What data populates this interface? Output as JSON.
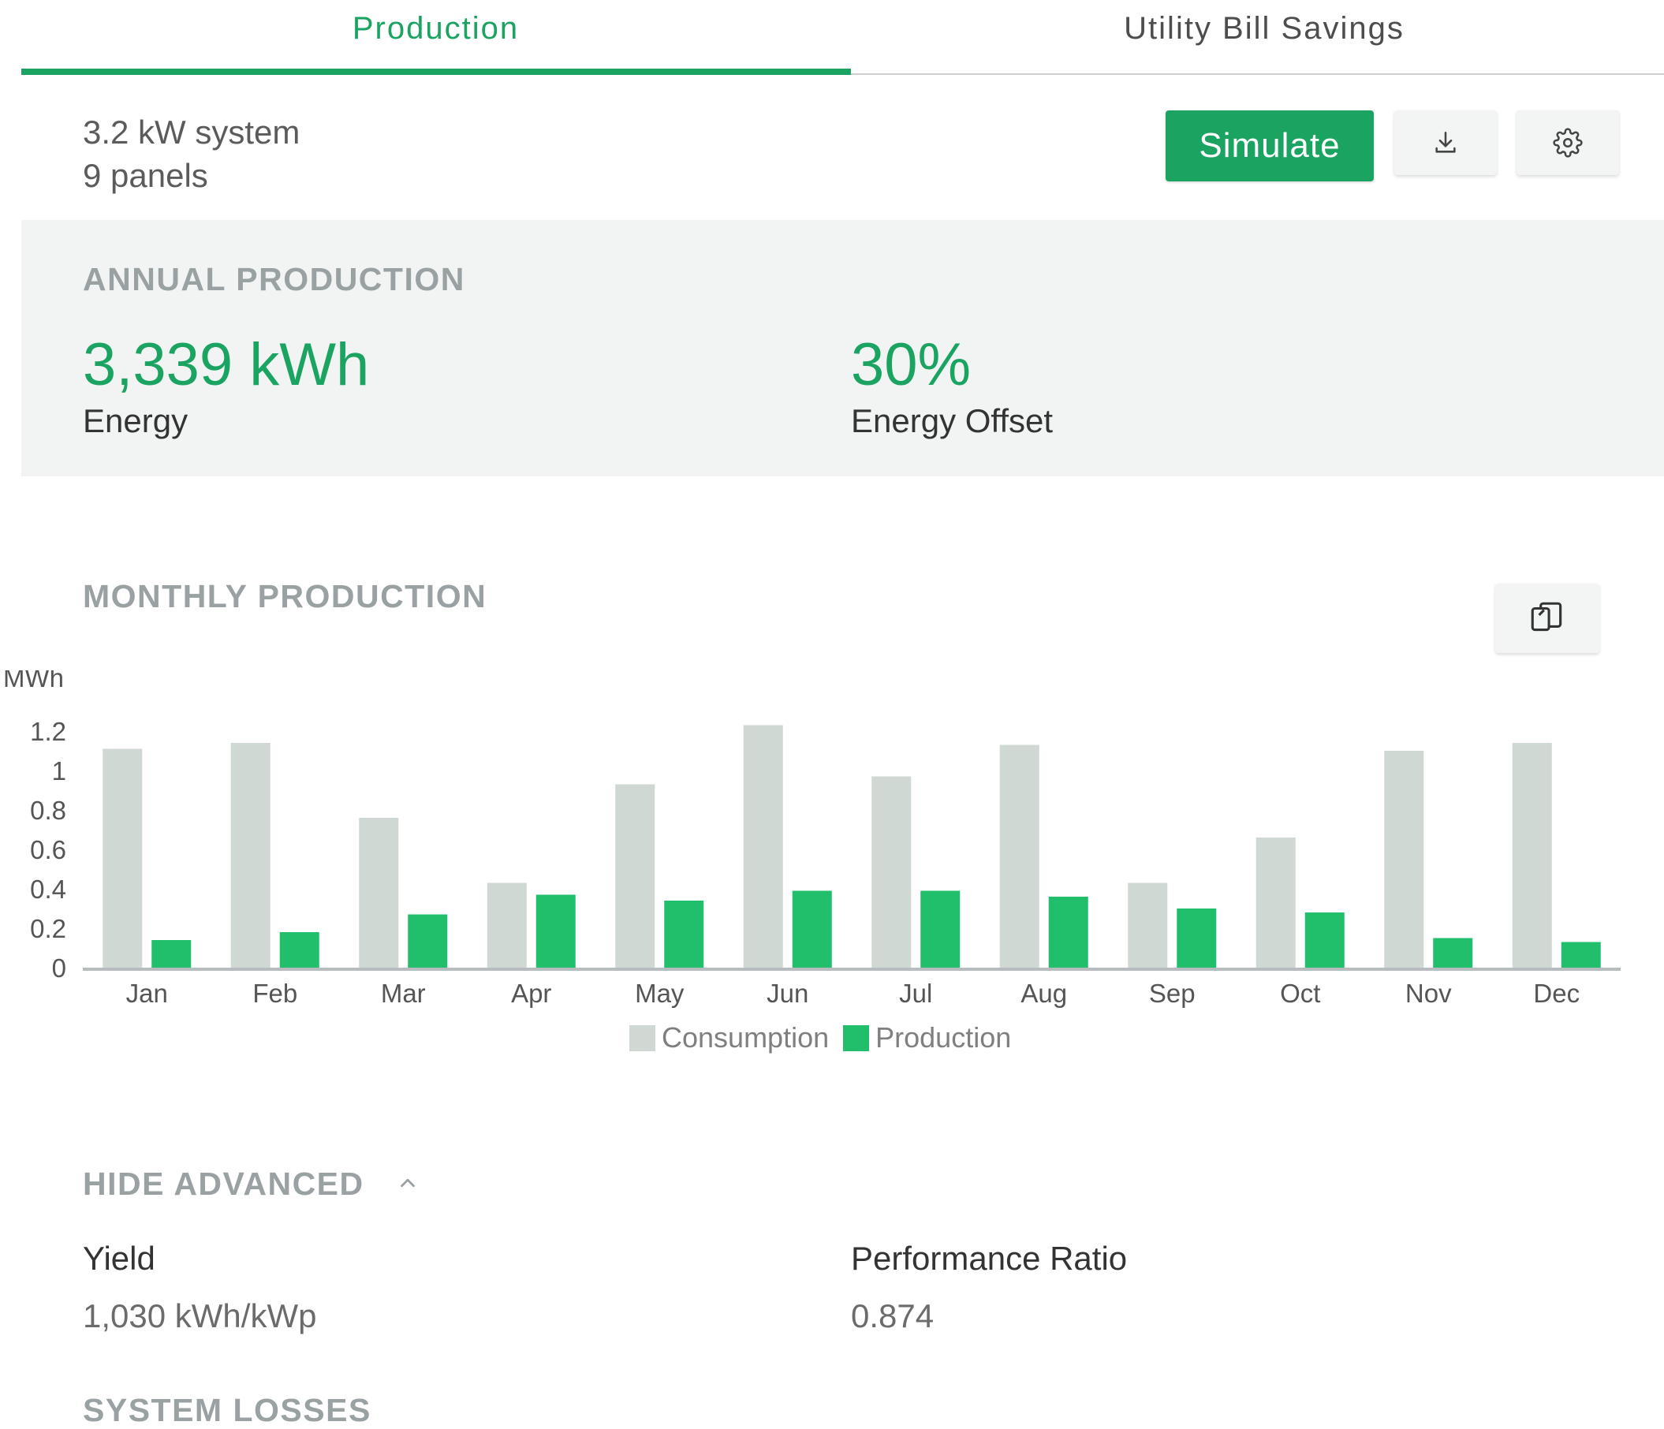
{
  "tabs": [
    {
      "label": "Production",
      "active": true
    },
    {
      "label": "Utility Bill Savings",
      "active": false
    }
  ],
  "system": {
    "size": "3.2 kW system",
    "panels": "9 panels"
  },
  "actions": {
    "simulate_label": "Simulate",
    "download_icon": "download-icon",
    "settings_icon": "gear-icon"
  },
  "annual": {
    "title": "ANNUAL PRODUCTION",
    "energy_value": "3,339 kWh",
    "energy_label": "Energy",
    "offset_value": "30%",
    "offset_label": "Energy Offset"
  },
  "monthly": {
    "title": "MONTHLY PRODUCTION",
    "copy_icon": "copy-icon"
  },
  "colors": {
    "accent": "#1aa361",
    "bar_production": "#21be6b",
    "bar_consumption": "#cfd8d3",
    "axis": "#b7bcbf"
  },
  "chart_data": {
    "type": "bar",
    "ylabel": "MWh",
    "ylim": [
      0,
      1.2
    ],
    "yticks": [
      "0",
      "0.2",
      "0.4",
      "0.6",
      "0.8",
      "1",
      "1.2"
    ],
    "categories": [
      "Jan",
      "Feb",
      "Mar",
      "Apr",
      "May",
      "Jun",
      "Jul",
      "Aug",
      "Sep",
      "Oct",
      "Nov",
      "Dec"
    ],
    "series": [
      {
        "name": "Consumption",
        "values": [
          1.11,
          1.14,
          0.76,
          0.43,
          0.93,
          1.23,
          0.97,
          1.13,
          0.43,
          0.66,
          1.1,
          1.14
        ]
      },
      {
        "name": "Production",
        "values": [
          0.14,
          0.18,
          0.27,
          0.37,
          0.34,
          0.39,
          0.39,
          0.36,
          0.3,
          0.28,
          0.15,
          0.13
        ]
      }
    ],
    "legend": "bottom"
  },
  "advanced": {
    "toggle_label": "HIDE ADVANCED",
    "yield_label": "Yield",
    "yield_value": "1,030 kWh/kWp",
    "pr_label": "Performance Ratio",
    "pr_value": "0.874"
  },
  "losses_title": "SYSTEM LOSSES"
}
